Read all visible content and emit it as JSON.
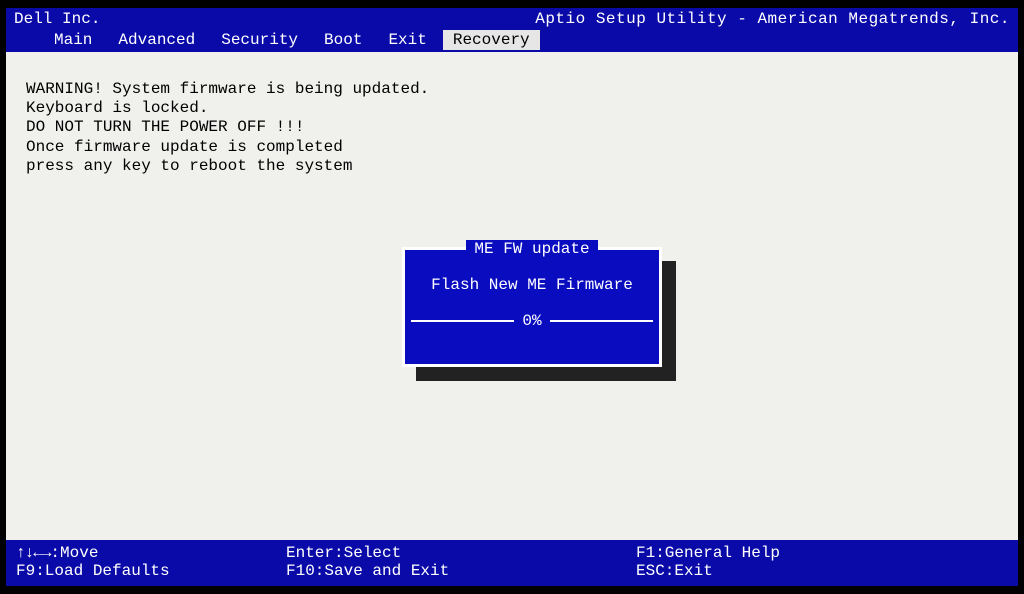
{
  "header": {
    "vendor": "Dell Inc.",
    "utility": "Aptio Setup Utility - American Megatrends, Inc."
  },
  "tabs": {
    "items": [
      {
        "label": "Main"
      },
      {
        "label": "Advanced"
      },
      {
        "label": "Security"
      },
      {
        "label": "Boot"
      },
      {
        "label": "Exit"
      },
      {
        "label": "Recovery",
        "active": true
      }
    ]
  },
  "warning": {
    "line1": "WARNING! System firmware is being updated.",
    "line2": "Keyboard is locked.",
    "line3": "DO NOT TURN THE POWER OFF !!!",
    "line4": "Once firmware update is completed",
    "line5": "press any key to reboot the system"
  },
  "dialog": {
    "title": "ME FW update",
    "body": "Flash New ME Firmware",
    "progress": "0%"
  },
  "footer": {
    "row1": {
      "col1_prefix": "↑↓←→",
      "col1_suffix": ":Move",
      "col2": "Enter:Select",
      "col3": "F1:General Help"
    },
    "row2": {
      "col1": "F9:Load Defaults",
      "col2": "F10:Save and Exit",
      "col3": "ESC:Exit"
    }
  }
}
